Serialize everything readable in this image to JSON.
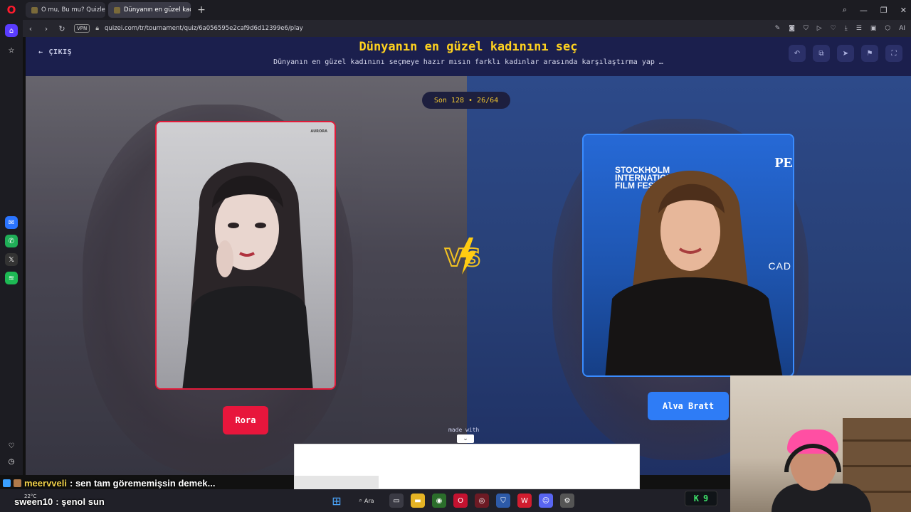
{
  "browser": {
    "tabs": [
      {
        "label": "O mu, Bu mu? Quizleri | Tü"
      },
      {
        "label": "Dünyanın en güzel kadını"
      }
    ],
    "url": "quizei.com/tr/tournament/quiz/6a056595e2caf9d6d12399e6/play",
    "vpn_label": "VPN",
    "ai_label": "AI"
  },
  "header": {
    "exit_label": "ÇIKIŞ",
    "title": "Dünyanın en güzel kadınını seç",
    "subtitle": "Dünyanın en güzel kadınını seçmeye hazır mısın farklı kadınlar arasında karşılaştırma yap …"
  },
  "round": {
    "label": "Son 128 • 26/64"
  },
  "contestants": {
    "left": {
      "name": "Rora",
      "watermark": "AURORA"
    },
    "right": {
      "name": "Alva Bratt",
      "poster_lines": [
        "STOCKHOLM",
        "INTERNATIONAL",
        "FILM FEST"
      ],
      "poster_brand": "PE",
      "poster_brand2": "CAD"
    }
  },
  "footer": {
    "made_with": "made with"
  },
  "chat": [
    {
      "user": "meervveli",
      "message": ": sen tam görememişsin demek..."
    },
    {
      "user": "sween10",
      "message": ": şenol sun"
    }
  ],
  "taskbar": {
    "weather": "22°C",
    "search_label": "Ara"
  },
  "overlay_badge": {
    "letter": "K",
    "count": "9"
  },
  "colors": {
    "title": "#ffd21f",
    "left_accent": "#e8163c",
    "right_accent": "#2e7cf6"
  }
}
